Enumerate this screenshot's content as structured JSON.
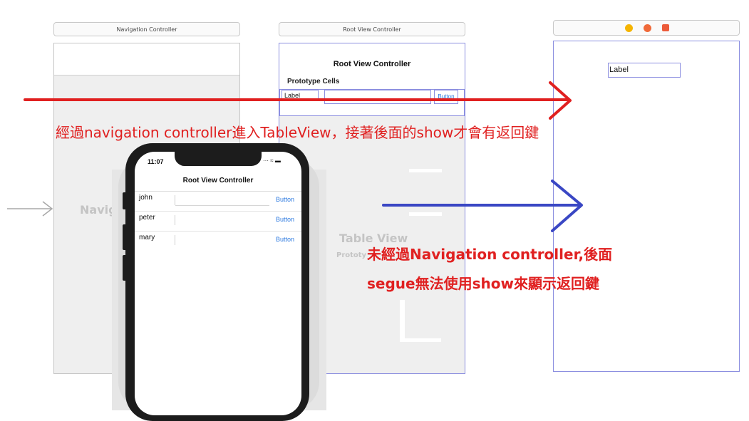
{
  "scenes": {
    "nav_controller": {
      "title": "Navigation Controller",
      "ghost_label": "Naviga"
    },
    "root_view_controller": {
      "bar_title": "Root View Controller",
      "nav_title": "Root View Controller",
      "prototype_cells_header": "Prototype Cells",
      "cell_label": "Label",
      "cell_button": "Button",
      "ghost_title": "Table View",
      "ghost_subtitle": "Prototy"
    },
    "detail": {
      "label": "Label"
    }
  },
  "phone": {
    "time": "11:07",
    "status_icons": "··· ≈ ▬",
    "nav_title": "Root View Controller",
    "rows": [
      {
        "name": "john",
        "button": "Button"
      },
      {
        "name": "peter",
        "button": "Button"
      },
      {
        "name": "mary",
        "button": "Button"
      }
    ]
  },
  "annotations": {
    "red_note": "經過navigation controller進入TableView，接著後面的show才會有返回鍵",
    "blue_note_line1": "未經過Navigation controller,後面",
    "blue_note_line2": "segue無法使用show來顯示返回鍵"
  },
  "colors": {
    "red_arrow": "#e02020",
    "blue_arrow": "#3a47c4",
    "annotation_text": "#e02020",
    "ios_blue": "#2d7ae0",
    "scene_border": "#c6c6c6",
    "selected_border": "#8c8fe0"
  },
  "icons": [
    "entry-arrow-icon",
    "view-controller-icon",
    "first-responder-icon",
    "exit-icon",
    "wifi-icon",
    "battery-icon"
  ]
}
